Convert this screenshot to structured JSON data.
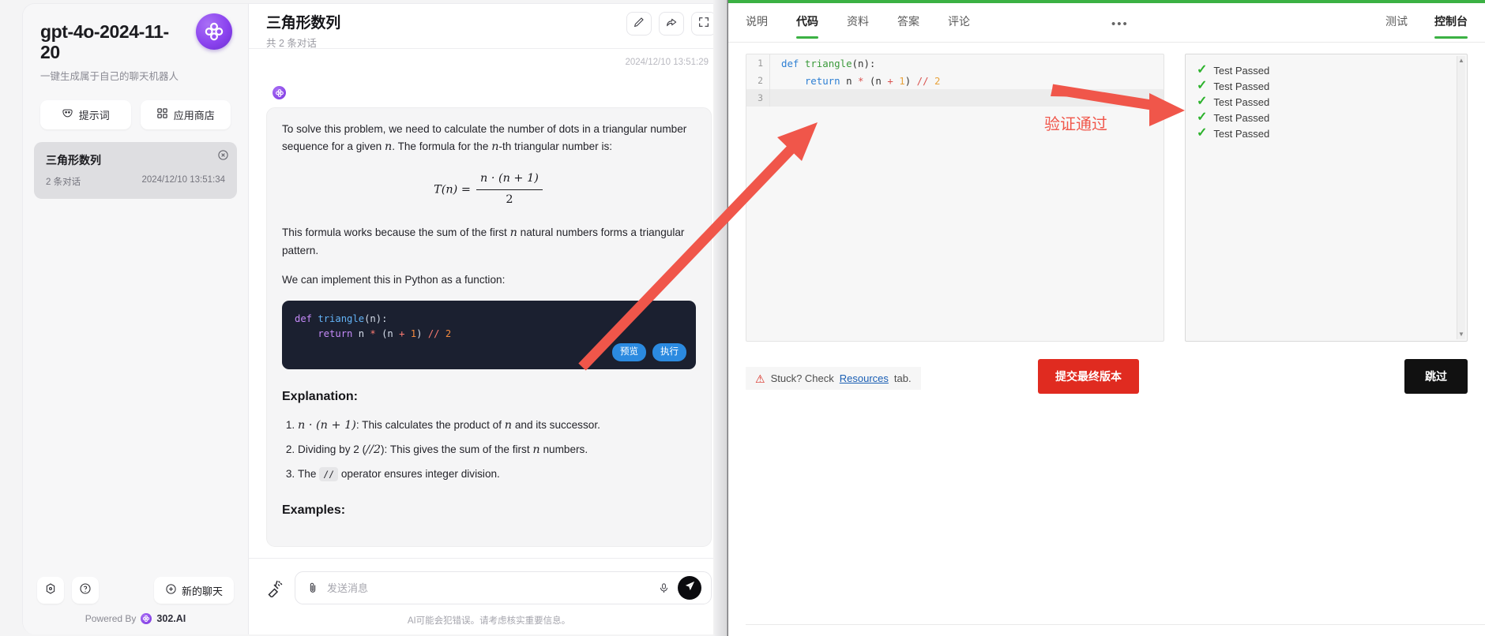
{
  "chat_app": {
    "sidebar": {
      "brand_title": "gpt-4o-2024-11-20",
      "brand_subtitle": "一键生成属于自己的聊天机器人",
      "logo_icon": "302-clover-logo-icon",
      "quick_buttons": [
        {
          "label": "提示词",
          "icon": "prompt-mask-icon"
        },
        {
          "label": "应用商店",
          "icon": "grid-apps-icon"
        }
      ],
      "conversations": [
        {
          "title": "三角形数列",
          "count": "2 条对话",
          "time": "2024/12/10 13:51:34",
          "close_icon": "close-circle-icon"
        }
      ],
      "footer": {
        "settings_icon": "settings-gear-icon",
        "help_icon": "help-question-icon",
        "new_chat_label": "新的聊天",
        "new_chat_icon": "plus-circle-icon",
        "powered_by_text": "Powered By",
        "powered_by_name": "302.AI",
        "powered_by_icon": "302-logo-icon"
      }
    },
    "header": {
      "title": "三角形数列",
      "subtitle": "共 2 条对话",
      "actions": [
        {
          "name": "edit-button",
          "icon": "pencil-icon"
        },
        {
          "name": "share-button",
          "icon": "share-arrow-icon"
        },
        {
          "name": "fullscreen-button",
          "icon": "expand-corners-icon"
        }
      ]
    },
    "message": {
      "timestamp": "2024/12/10 13:51:29",
      "avatar_icon": "302-bot-avatar-icon",
      "para1_a": "To solve this problem, we need to calculate the number of dots in a triangular number sequence for a given ",
      "para1_n": "n",
      "para1_b": ". The formula for the ",
      "para1_c": "-th triangular number is:",
      "formula": {
        "lhs": "T(n)  =",
        "numerator": "n · (n + 1)",
        "denominator": "2"
      },
      "para2_a": "This formula works because the sum of the first ",
      "para2_b": " natural numbers forms a triangular pattern.",
      "para3": "We can implement this in Python as a function:",
      "code": {
        "line1_kw": "def",
        "line1_fn": " triangle",
        "line1_rest": "(n):",
        "line2_kw": "    return",
        "line2_a": " n ",
        "line2_op1": "*",
        "line2_b": " (n ",
        "line2_op2": "+",
        "line2_num1": " 1",
        "line2_c": ") ",
        "line2_op3": "//",
        "line2_num2": " 2",
        "preview_label": "预览",
        "run_label": "执行"
      },
      "explanation_heading": "Explanation:",
      "list_items": [
        {
          "math": "n · (n + 1)",
          "text": ": This calculates the product of ",
          "n": "n",
          "tail": " and its successor."
        },
        {
          "pre": "Dividing by 2 (",
          "math": "//2",
          "text": "): This gives the sum of the first ",
          "n": "n",
          "tail": " numbers."
        },
        {
          "pre": "The ",
          "code": "//",
          "tail": " operator ensures integer division."
        }
      ],
      "examples_heading": "Examples:"
    },
    "composer": {
      "broom_icon": "clear-broom-icon",
      "attach_icon": "paperclip-icon",
      "placeholder": "发送消息",
      "value": "",
      "mic_icon": "microphone-icon",
      "send_icon": "send-paper-plane-icon",
      "disclaimer": "AI可能会犯错误。请考虑核实重要信息。"
    }
  },
  "code_app": {
    "left_tabs": [
      {
        "label": "说明",
        "active": false
      },
      {
        "label": "代码",
        "active": true
      },
      {
        "label": "资料",
        "active": false
      },
      {
        "label": "答案",
        "active": false
      },
      {
        "label": "评论",
        "active": false
      }
    ],
    "more_menu": {
      "label": "•••",
      "icon": "more-horizontal-icon"
    },
    "right_tabs": [
      {
        "label": "测试",
        "active": false
      },
      {
        "label": "控制台",
        "active": true
      }
    ],
    "editor": {
      "lines": [
        {
          "no": "1",
          "active": false,
          "kw": "def",
          "sp1": " ",
          "fn": "triangle",
          "rest": "(n):",
          "indent": ""
        },
        {
          "no": "2",
          "active": false,
          "kw": "return",
          "indent": "    ",
          "rest": ""
        },
        {
          "no": "3",
          "active": true,
          "indent": "",
          "rest": ""
        }
      ],
      "line2_parts": {
        "indent": "    ",
        "kw": "return",
        "a": " n ",
        "op1": "*",
        "b": " (n ",
        "op2": "+",
        "num1": " 1",
        "c": ") ",
        "op3": "//",
        "num2": " 2"
      }
    },
    "console": {
      "results": [
        {
          "status_icon": "check-mark-icon",
          "label": "Test Passed"
        },
        {
          "status_icon": "check-mark-icon",
          "label": "Test Passed"
        },
        {
          "status_icon": "check-mark-icon",
          "label": "Test Passed"
        },
        {
          "status_icon": "check-mark-icon",
          "label": "Test Passed"
        },
        {
          "status_icon": "check-mark-icon",
          "label": "Test Passed"
        }
      ],
      "scroll_up_icon": "triangle-up-icon",
      "scroll_down_icon": "triangle-down-icon"
    },
    "actions": {
      "stuck_icon": "warning-triangle-icon",
      "stuck_prefix": "Stuck? Check ",
      "stuck_link": "Resources",
      "stuck_suffix": " tab.",
      "submit_label": "提交最终版本",
      "skip_label": "跳过"
    }
  },
  "annotations": {
    "verify_label": "验证通过",
    "arrow_color": "#f0564a"
  },
  "colors": {
    "accent_green": "#3bb143",
    "accent_purple": "#8b43ef",
    "submit_red": "#e02b20",
    "annotation_red": "#f0564a",
    "code_bg": "#1b2030"
  }
}
